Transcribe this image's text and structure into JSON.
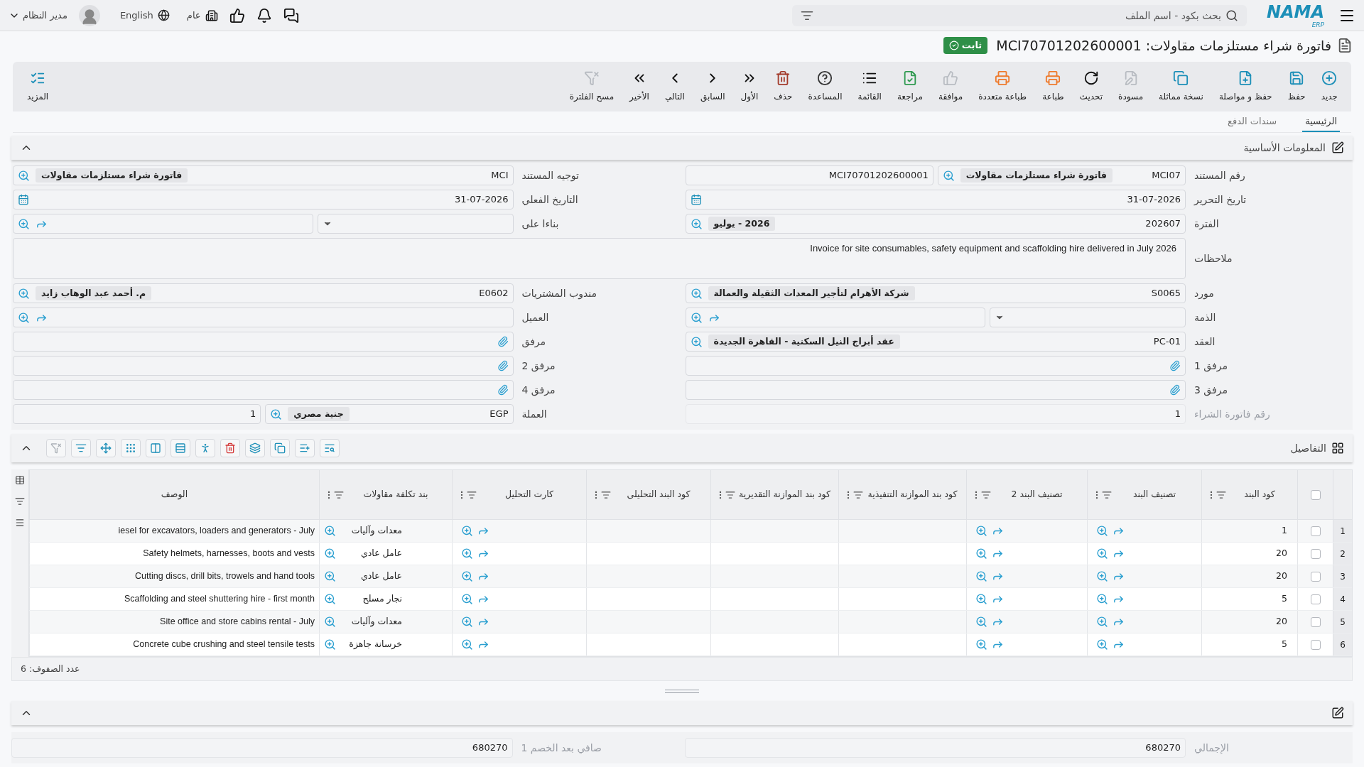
{
  "topbar": {
    "logo": "NAMA",
    "logo_sub": "ERP",
    "search": {
      "placeholder": "بحث بكود - اسم الملف"
    },
    "user": "مدير النظام",
    "language": "English",
    "branch": "عام"
  },
  "title": {
    "text": "فاتورة شراء مستلزمات مقاولات: MCI70701202600001",
    "status": "ثابت"
  },
  "toolbar": [
    {
      "label": "جديد",
      "disabled": false
    },
    {
      "label": "حفظ",
      "disabled": false
    },
    {
      "label": "حفظ و مواصلة",
      "disabled": false
    },
    {
      "label": "نسخة مماثلة",
      "disabled": false
    },
    {
      "label": "مسودة",
      "disabled": true
    },
    {
      "label": "تحديث",
      "disabled": false
    },
    {
      "label": "طباعة",
      "disabled": false
    },
    {
      "label": "طباعة متعددة",
      "disabled": false
    },
    {
      "label": "موافقة",
      "disabled": true
    },
    {
      "label": "مراجعة",
      "disabled": false
    },
    {
      "label": "القائمة",
      "disabled": false
    },
    {
      "label": "المساعدة",
      "disabled": false
    },
    {
      "label": "حذف",
      "disabled": false
    },
    {
      "label": "الأول",
      "disabled": false
    },
    {
      "label": "السابق",
      "disabled": false
    },
    {
      "label": "التالي",
      "disabled": false
    },
    {
      "label": "الأخير",
      "disabled": false
    },
    {
      "label": "مسح الفلترة",
      "disabled": true
    }
  ],
  "more": {
    "label": "المزيد"
  },
  "tabs": [
    {
      "label": "الرئيسية",
      "selected": true
    },
    {
      "label": "سندات الدفع",
      "selected": false
    }
  ],
  "basic_section": {
    "title": "المعلومات الأساسية",
    "expanded": true
  },
  "form_rows": [
    {
      "fields": [
        {
          "label": "رقم المستند",
          "kind": "lookup",
          "value": "MCI07",
          "name": "فاتورة شراء مستلزمات مقاولات",
          "extra": "MCI70701202600001"
        },
        {
          "label": "توجيه المستند",
          "kind": "lookup",
          "value": "MCI",
          "name": "فاتورة شراء مستلزمات مقاولات"
        }
      ]
    },
    {
      "fields": [
        {
          "label": "تاريخ التحرير",
          "kind": "date",
          "value": "31-07-2026"
        },
        {
          "label": "التاريخ الفعلي",
          "kind": "date",
          "value": "31-07-2026"
        }
      ]
    },
    {
      "fields": [
        {
          "label": "الفترة",
          "kind": "lookup",
          "value": "202607",
          "name": "2026 - يوليو"
        },
        {
          "label": "بناءا على",
          "kind": "select-link"
        }
      ]
    },
    {
      "fields": [
        {
          "label": "ملاحظات",
          "kind": "notes",
          "value": "Invoice for site consumables, safety equipment and scaffolding hire delivered in July 2026"
        }
      ]
    },
    {
      "fields": [
        {
          "label": "مورد",
          "kind": "lookup",
          "value": "S0065",
          "name": "شركة الأهرام لتأجير المعدات الثقيلة والعمالة"
        },
        {
          "label": "مندوب المشتريات",
          "kind": "lookup",
          "value": "E0602",
          "name": "م. أحمد عبد الوهاب زايد"
        }
      ]
    },
    {
      "fields": [
        {
          "label": "الذمة",
          "kind": "select-link"
        },
        {
          "label": "العميل",
          "kind": "link"
        }
      ]
    },
    {
      "fields": [
        {
          "label": "العقد",
          "kind": "lookup",
          "value": "PC-01",
          "name": "عقد أبراج النيل السكنية - القاهرة الجديدة"
        },
        {
          "label": "مرفق",
          "kind": "attachment"
        }
      ]
    },
    {
      "fields": [
        {
          "label": "مرفق 1",
          "kind": "attachment"
        },
        {
          "label": "مرفق 2",
          "kind": "attachment"
        }
      ]
    },
    {
      "fields": [
        {
          "label": "مرفق 3",
          "kind": "attachment"
        },
        {
          "label": "مرفق 4",
          "kind": "attachment"
        }
      ]
    },
    {
      "fields": [
        {
          "label": "رقم فاتورة الشراء",
          "kind": "text",
          "value": "1",
          "disabled": true
        },
        {
          "label": "العملة",
          "kind": "lookup",
          "value": "EGP",
          "name": "جنية مصري",
          "extra": "1"
        }
      ]
    }
  ],
  "details": {
    "title": "التفاصيل",
    "expanded": true,
    "all_checked": false,
    "columns": [
      {
        "label": "كود البند",
        "kind": "code"
      },
      {
        "label": "تصنيف البند",
        "kind": "link"
      },
      {
        "label": "تصنيف البند 2",
        "kind": "link"
      },
      {
        "label": "كود بند الموازنة التنفيذية",
        "kind": "blank"
      },
      {
        "label": "كود بند الموازنة التقديرية",
        "kind": "blank"
      },
      {
        "label": "كود البند التحليلى",
        "kind": "blank"
      },
      {
        "label": "كارت التحليل",
        "kind": "link"
      },
      {
        "label": "بند تكلفة مقاولات",
        "kind": "cost"
      },
      {
        "label": "الوصف",
        "kind": "description"
      }
    ],
    "rows": [
      {
        "num": "1",
        "checked": false,
        "code": "1",
        "cost_item": "معدات وآليات",
        "description": "iesel for excavators, loaders and generators - July"
      },
      {
        "num": "2",
        "checked": false,
        "code": "20",
        "cost_item": "عامل عادي",
        "description": "Safety helmets, harnesses, boots and vests"
      },
      {
        "num": "3",
        "checked": false,
        "code": "20",
        "cost_item": "عامل عادي",
        "description": "Cutting discs, drill bits, trowels and hand tools"
      },
      {
        "num": "4",
        "checked": false,
        "code": "5",
        "cost_item": "نجار مسلح",
        "description": "Scaffolding and steel shuttering hire - first month"
      },
      {
        "num": "5",
        "checked": false,
        "code": "20",
        "cost_item": "معدات وآليات",
        "description": "Site office and store cabins rental - July"
      },
      {
        "num": "6",
        "checked": false,
        "code": "5",
        "cost_item": "خرسانة جاهزة",
        "description": "Concrete cube crushing and steel tensile tests"
      }
    ],
    "row_count": "عدد الصفوف: 6"
  },
  "totals": {
    "expanded": true,
    "fields": [
      {
        "label": "الإجمالي",
        "value": "680270"
      },
      {
        "label": "صافي بعد الخصم 1",
        "value": "680270"
      }
    ]
  }
}
